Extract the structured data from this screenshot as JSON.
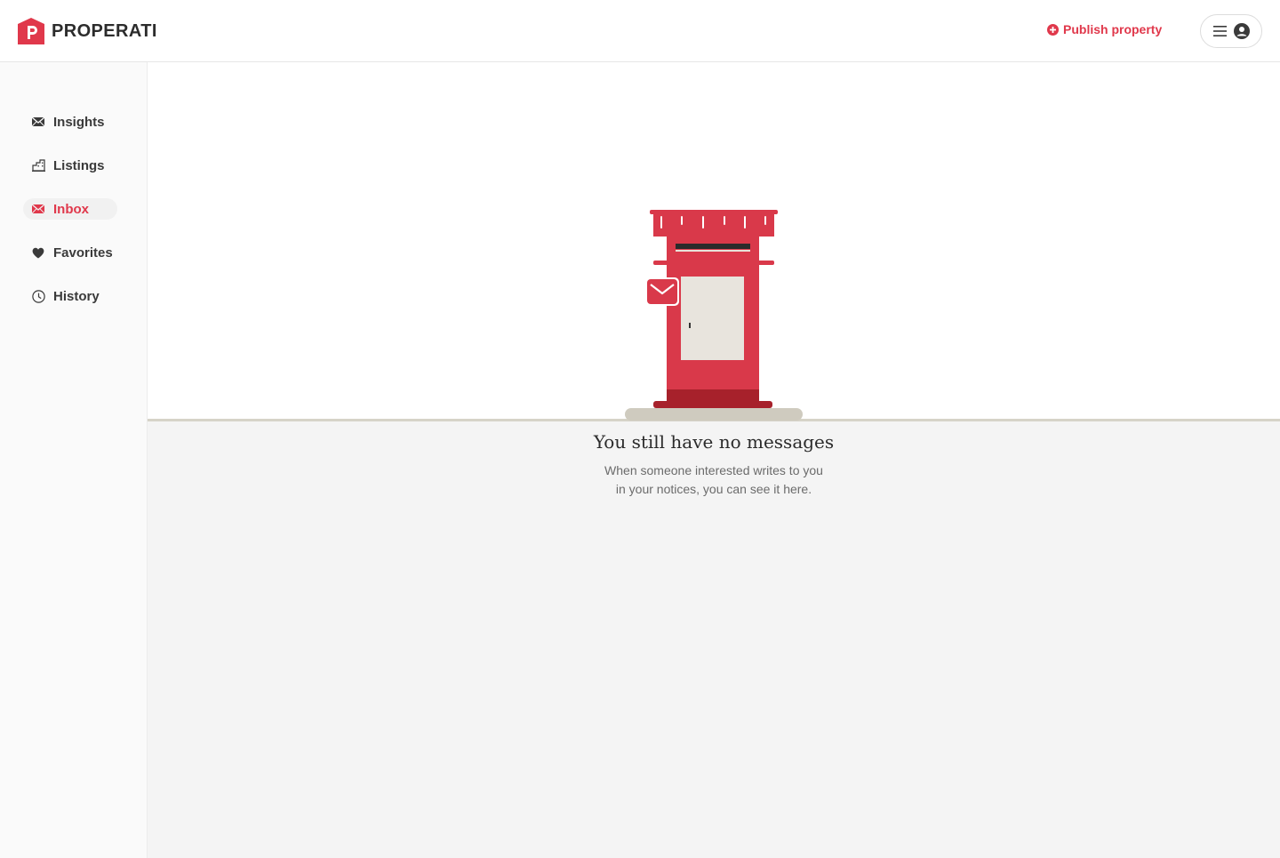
{
  "brand": {
    "name": "PROPERATI",
    "color": "#e0384b"
  },
  "header": {
    "publish_label": "Publish property",
    "publish_icon": "plus-circle-icon",
    "menu_icons": [
      "hamburger-icon",
      "user-avatar-icon"
    ]
  },
  "sidebar": {
    "items": [
      {
        "label": "Insights",
        "icon": "envelope-icon",
        "active": false
      },
      {
        "label": "Listings",
        "icon": "building-icon",
        "active": false
      },
      {
        "label": "Inbox",
        "icon": "envelope-icon",
        "active": true
      },
      {
        "label": "Favorites",
        "icon": "heart-icon",
        "active": false
      },
      {
        "label": "History",
        "icon": "clock-icon",
        "active": false
      }
    ]
  },
  "empty_state": {
    "title": "You still have no messages",
    "line1": "When someone interested writes to you",
    "line2": "in your notices, you can see it here.",
    "illustration": "mailbox-illustration"
  }
}
